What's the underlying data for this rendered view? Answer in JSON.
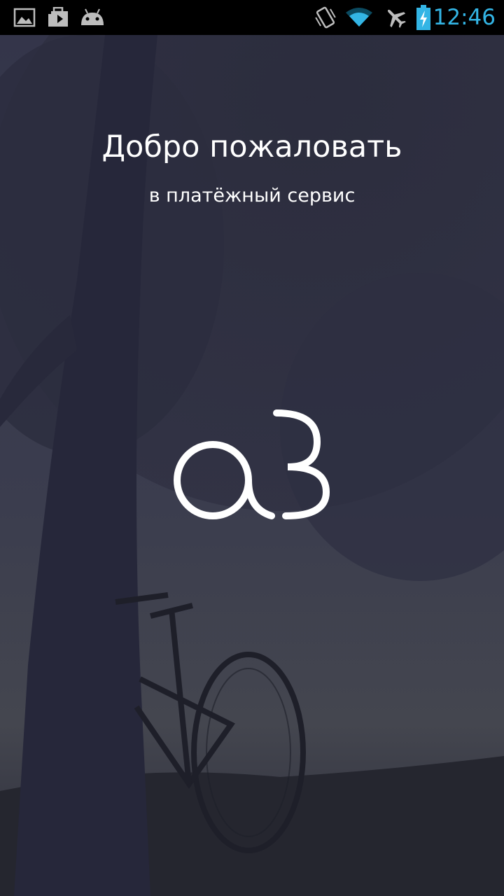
{
  "status_bar": {
    "time": "12:46",
    "time_color": "#33b5e5",
    "left_icons": [
      "gallery-icon",
      "play-store-icon",
      "android-icon"
    ],
    "right_icons": [
      "vibrate-icon",
      "wifi-icon",
      "airplane-icon",
      "battery-charging-icon"
    ]
  },
  "welcome": {
    "title": "Добро пожаловать",
    "subtitle": "в платёжный сервис"
  },
  "logo": {
    "icon": "a3-logo-icon"
  },
  "colors": {
    "overlay": "#2d2e3f",
    "text": "#ffffff",
    "accent": "#33b5e5"
  }
}
